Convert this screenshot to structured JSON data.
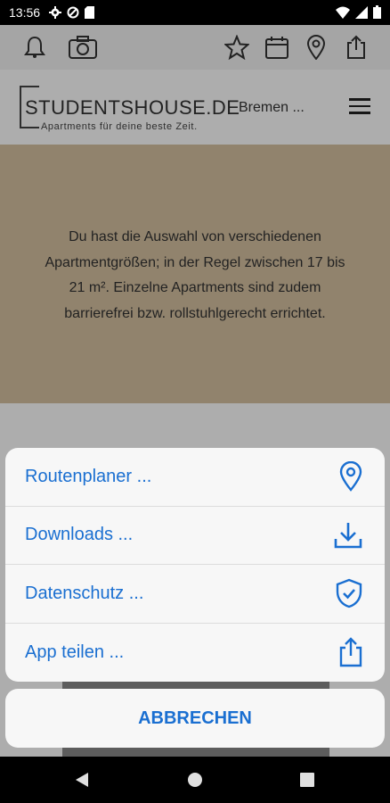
{
  "status": {
    "time": "13:56"
  },
  "header": {
    "logo_main": "STUDENTSHOUSE.DE",
    "logo_tagline": "Apartments für deine beste Zeit.",
    "city": "Bremen ..."
  },
  "content": {
    "text": "Du hast die Auswahl von verschiedenen Apartmentgrößen; in der Regel zwischen 17 bis 21 m². Einzelne Apartments sind zudem barrierefrei bzw. rollstuhlgerecht errichtet."
  },
  "sheet": {
    "items": [
      {
        "label": "Routenplaner ...",
        "icon": "map-pin-icon"
      },
      {
        "label": "Downloads ...",
        "icon": "download-icon"
      },
      {
        "label": "Datenschutz ...",
        "icon": "shield-check-icon"
      },
      {
        "label": "App teilen ...",
        "icon": "share-icon"
      }
    ],
    "cancel_label": "ABBRECHEN"
  },
  "colors": {
    "accent": "#1a6fd1",
    "content_bg": "#d6c1a1"
  }
}
